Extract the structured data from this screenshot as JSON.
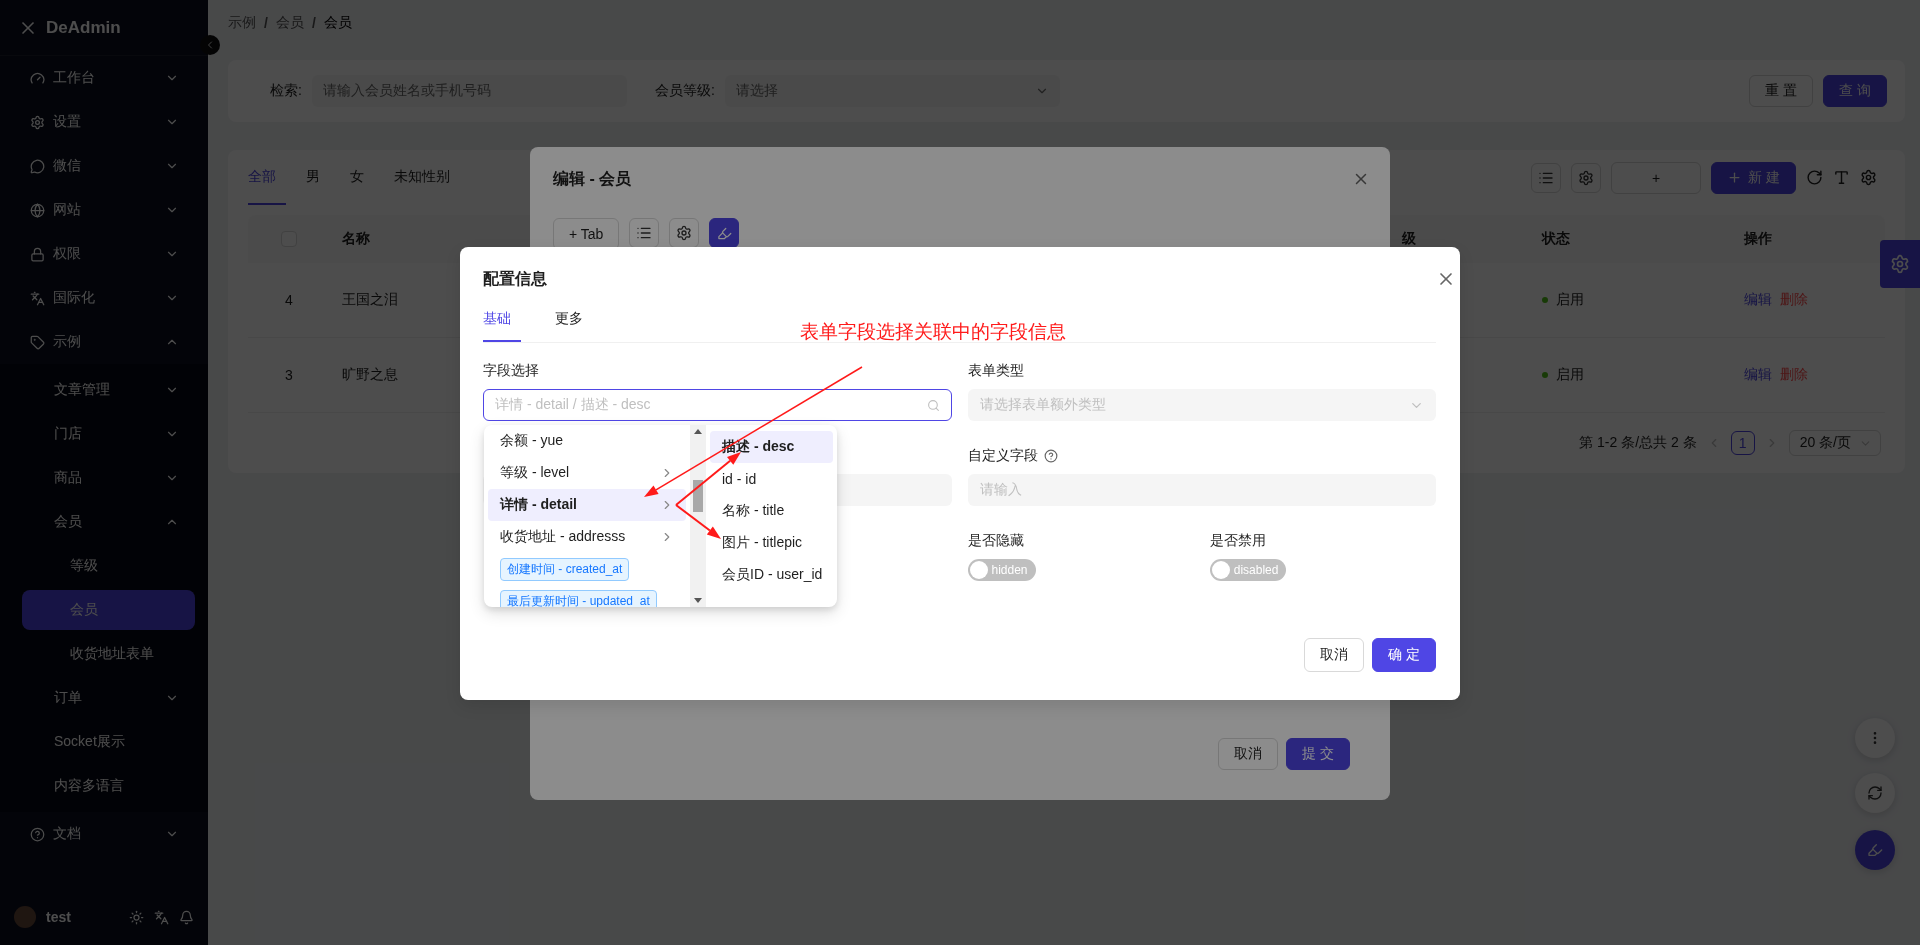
{
  "sidebar": {
    "logo": "DeAdmin",
    "items": [
      {
        "label": "工作台",
        "kind": "submenu",
        "expanded": false
      },
      {
        "label": "设置",
        "kind": "submenu",
        "expanded": false
      },
      {
        "label": "微信",
        "kind": "submenu",
        "expanded": false
      },
      {
        "label": "网站",
        "kind": "submenu",
        "expanded": false
      },
      {
        "label": "权限",
        "kind": "submenu",
        "expanded": false
      },
      {
        "label": "国际化",
        "kind": "submenu",
        "expanded": false
      },
      {
        "label": "示例",
        "kind": "submenu",
        "expanded": true,
        "children": [
          {
            "label": "文章管理",
            "kind": "submenu",
            "expanded": false
          },
          {
            "label": "门店",
            "kind": "submenu",
            "expanded": false
          },
          {
            "label": "商品",
            "kind": "submenu",
            "expanded": false
          },
          {
            "label": "会员",
            "kind": "submenu",
            "expanded": true,
            "children": [
              {
                "label": "等级",
                "kind": "link",
                "selected": false
              },
              {
                "label": "会员",
                "kind": "link",
                "selected": true
              },
              {
                "label": "收货地址表单",
                "kind": "link",
                "selected": false
              }
            ]
          },
          {
            "label": "订单",
            "kind": "submenu",
            "expanded": false
          },
          {
            "label": "Socket展示",
            "kind": "link",
            "selected": false
          },
          {
            "label": "内容多语言",
            "kind": "link",
            "selected": false
          }
        ]
      },
      {
        "label": "文档",
        "kind": "submenu",
        "expanded": false
      }
    ],
    "user": {
      "name": "test"
    }
  },
  "breadcrumb": {
    "items": [
      "示例",
      "会员",
      "会员"
    ],
    "separator": "/"
  },
  "search": {
    "fields": [
      {
        "label": "检索:",
        "placeholder": "请输入会员姓名或手机号码",
        "kind": "input"
      },
      {
        "label": "会员等级:",
        "placeholder": "请选择",
        "kind": "select"
      }
    ],
    "buttons": [
      {
        "label": "重 置",
        "kind": "default"
      },
      {
        "label": "查 询",
        "kind": "primary"
      }
    ]
  },
  "table_card": {
    "tabs": [
      {
        "label": "全部",
        "selected": true
      },
      {
        "label": "男",
        "selected": false
      },
      {
        "label": "女",
        "selected": false
      },
      {
        "label": "未知性别",
        "selected": false
      }
    ],
    "toolbar": {
      "add_label": "+",
      "new_label": "新 建"
    },
    "header_checkbox": {
      "checked": false
    },
    "columns": [
      "名称",
      "级",
      "状态",
      "操作"
    ],
    "rows": [
      {
        "id": "4",
        "name": "王国之泪",
        "status": "启用",
        "actions": [
          "编辑",
          "删除"
        ]
      },
      {
        "id": "3",
        "name": "旷野之息",
        "status": "启用",
        "actions": [
          "编辑",
          "删除"
        ]
      }
    ],
    "pagination": {
      "summary": "第 1-2 条/总共 2 条",
      "pages": [
        {
          "label": "1",
          "selected": true
        }
      ],
      "page_size": "20 条/页"
    }
  },
  "edit_modal": {
    "title": "编辑 - 会员",
    "toolbar_button": "+ Tab",
    "buttons": [
      {
        "label": "取消",
        "kind": "default"
      },
      {
        "label": "提 交",
        "kind": "primary"
      }
    ]
  },
  "config_dialog": {
    "title": "配置信息",
    "tabs": [
      {
        "label": "基础",
        "selected": true
      },
      {
        "label": "更多",
        "selected": false
      }
    ],
    "field_select": {
      "label": "字段选择",
      "placeholder": "详情 - detail / 描述 - desc"
    },
    "form_type": {
      "label": "表单类型",
      "placeholder": "请选择表单额外类型"
    },
    "custom_field": {
      "label": "自定义字段",
      "placeholder": "请输入"
    },
    "switches": [
      {
        "label": "是否隐藏",
        "text": "hidden",
        "on": false
      },
      {
        "label": "是否禁用",
        "text": "disabled",
        "on": false
      }
    ],
    "cascader": {
      "columns": [
        [
          {
            "label": "余额 - yue",
            "kind": "option",
            "has_children": false,
            "active": false
          },
          {
            "label": "等级 - level",
            "kind": "option",
            "has_children": true,
            "active": false
          },
          {
            "label": "详情 - detail",
            "kind": "option",
            "has_children": true,
            "active": true
          },
          {
            "label": "收货地址 - addresss",
            "kind": "option",
            "has_children": true,
            "active": false
          },
          {
            "label": "创建时间 - created_at",
            "kind": "tag",
            "has_children": false,
            "active": false
          },
          {
            "label": "最后更新时间 - updated_at",
            "kind": "tag",
            "has_children": false,
            "active": false
          }
        ],
        [
          {
            "label": "描述 - desc",
            "kind": "option",
            "has_children": false,
            "active": true
          },
          {
            "label": "id - id",
            "kind": "option",
            "has_children": false,
            "active": false
          },
          {
            "label": "名称 - title",
            "kind": "option",
            "has_children": false,
            "active": false
          },
          {
            "label": "图片 - titlepic",
            "kind": "option",
            "has_children": false,
            "active": false
          },
          {
            "label": "会员ID - user_id",
            "kind": "option",
            "has_children": false,
            "active": false
          }
        ]
      ]
    },
    "buttons": [
      {
        "label": "取消",
        "kind": "default"
      },
      {
        "label": "确 定",
        "kind": "primary"
      }
    ]
  },
  "annotation": {
    "text": "表单字段选择关联中的字段信息"
  }
}
